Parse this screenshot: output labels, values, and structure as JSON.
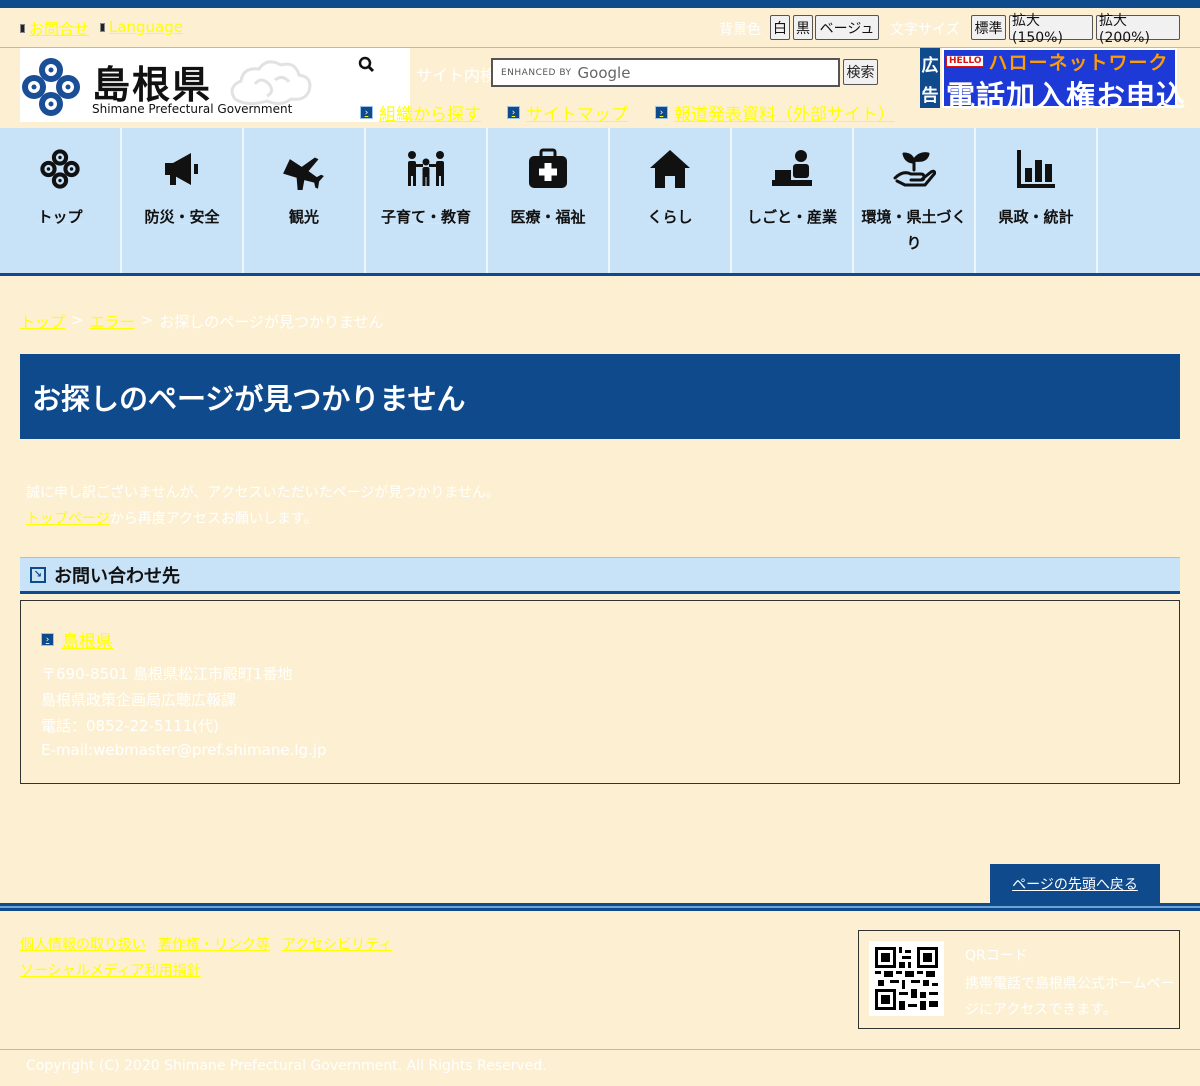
{
  "util": {
    "contact": "お問合せ",
    "language": "Language",
    "bg_label": "背景色",
    "bg_white": "白",
    "bg_black": "黒",
    "bg_beige": "ベージュ",
    "font_label": "文字サイズ",
    "font_normal": "標準",
    "font_150": "拡大(150%)",
    "font_200": "拡大(200%)"
  },
  "logo": {
    "jp": "島根県",
    "en": "Shimane Prefectural Government"
  },
  "search": {
    "label": "サイト内検索",
    "enhanced_by": "ENHANCED BY",
    "google": "Google",
    "button": "検索"
  },
  "sub_links": {
    "org": "組織から探す",
    "sitemap": "サイトマップ",
    "press": "報道発表資料（外部サイト）"
  },
  "ad": {
    "tag_1": "広",
    "tag_2": "告",
    "hello": "HELLO",
    "network": "ハローネットワーク",
    "main": "電話加入権お申込"
  },
  "gnav": [
    {
      "label": "トップ",
      "icon": "shimane-logo-icon"
    },
    {
      "label": "防災・安全",
      "icon": "megaphone-icon"
    },
    {
      "label": "観光",
      "icon": "airplane-icon"
    },
    {
      "label": "子育て・教育",
      "icon": "family-icon"
    },
    {
      "label": "医療・福祉",
      "icon": "medical-kit-icon"
    },
    {
      "label": "くらし",
      "icon": "house-icon"
    },
    {
      "label": "しごと・産業",
      "icon": "worker-icon"
    },
    {
      "label": "環境・県土づくり",
      "icon": "sprout-hand-icon"
    },
    {
      "label": "県政・統計",
      "icon": "bar-chart-icon"
    }
  ],
  "breadcrumb": {
    "top": "トップ",
    "sep": ">",
    "error": "エラー",
    "current": "お探しのページが見つかりません"
  },
  "page_title": "お探しのページが見つかりません",
  "message": {
    "line1": "誠に申し訳ございませんが、アクセスいただいたページが見つかりません。",
    "link": "トップページ",
    "line2_rest": "から再度アクセスお願いします。"
  },
  "contact": {
    "heading": "お問い合わせ先",
    "org": "島根県",
    "address": "〒690-8501 島根県松江市殿町1番地",
    "dept": "島根県政策企画局広聴広報課",
    "tel": "電話：0852-22-5111(代)",
    "email": "E-mail:webmaster@pref.shimane.lg.jp"
  },
  "pagetop": "ページの先頭へ戻る",
  "footer": {
    "privacy": "個人情報の取り扱い",
    "copyright_link": "著作権・リンク等",
    "accessibility": "アクセシビリティ",
    "social": "ソーシャルメディア利用指針",
    "qr_title": "QRコード",
    "qr_desc": "携帯電話で島根県公式ホームページにアクセスできます。",
    "copyright": "Copyright (C) 2020 Shimane Prefectural Government. All Rights Reserved."
  },
  "colors": {
    "background": "#fdf0d2",
    "brand_blue": "#0f4a8c",
    "nav_bg": "#c8e2f7",
    "link": "#ffff00"
  }
}
